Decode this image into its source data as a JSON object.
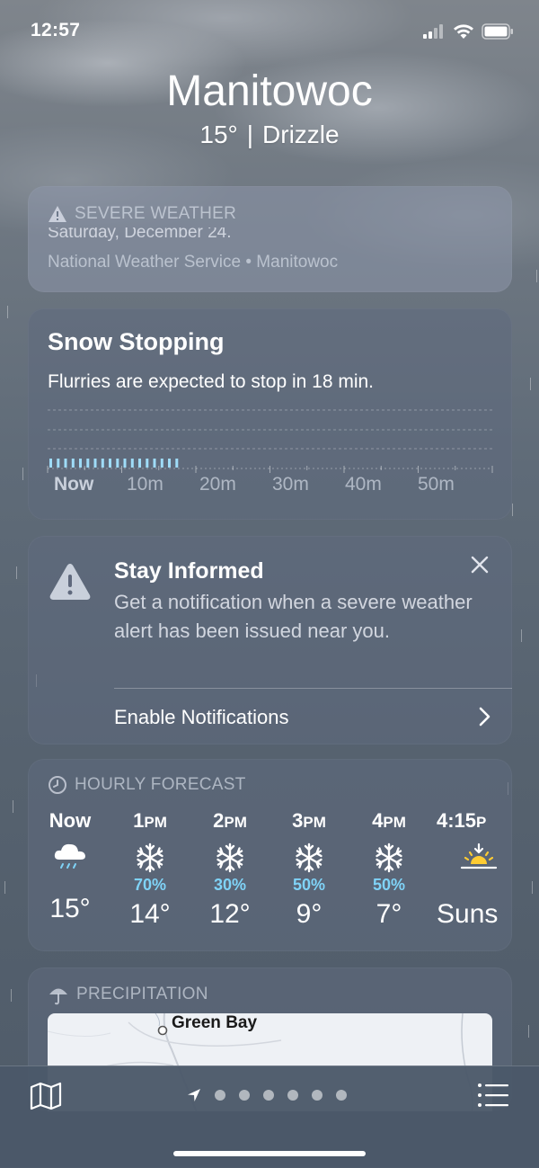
{
  "status_bar": {
    "time": "12:57"
  },
  "header": {
    "city": "Manitowoc",
    "temperature": "15°",
    "condition": "Drizzle"
  },
  "severe": {
    "heading": "SEVERE WEATHER",
    "cut_text": "Saturday, December 24.",
    "source": "National Weather Service • Manitowoc"
  },
  "snow": {
    "title": "Snow Stopping",
    "description": "Flurries are expected to stop in 18 min.",
    "ticks": [
      "Now",
      "10m",
      "20m",
      "30m",
      "40m",
      "50m"
    ],
    "minutes_with_precipitation": 18
  },
  "inform": {
    "title": "Stay Informed",
    "body": "Get a notification when a severe weather alert has been issued near you.",
    "action": "Enable Notifications"
  },
  "hourly": {
    "heading": "HOURLY FORECAST",
    "items": [
      {
        "time": "Now",
        "suffix": "",
        "icon": "cloud-drizzle-icon",
        "chance": "",
        "temp": "15°"
      },
      {
        "time": "1",
        "suffix": "PM",
        "icon": "snowflake-icon",
        "chance": "70%",
        "temp": "14°"
      },
      {
        "time": "2",
        "suffix": "PM",
        "icon": "snowflake-icon",
        "chance": "30%",
        "temp": "12°"
      },
      {
        "time": "3",
        "suffix": "PM",
        "icon": "snowflake-icon",
        "chance": "50%",
        "temp": "9°"
      },
      {
        "time": "4",
        "suffix": "PM",
        "icon": "snowflake-icon",
        "chance": "50%",
        "temp": "7°"
      },
      {
        "time": "4:15",
        "suffix": "P",
        "icon": "sunset-icon",
        "chance": "",
        "temp": "Suns"
      }
    ]
  },
  "precipitation": {
    "heading": "PRECIPITATION",
    "map_label": "Green Bay"
  },
  "colors": {
    "chance": "#7fd3f7",
    "card": "#5f697d"
  }
}
